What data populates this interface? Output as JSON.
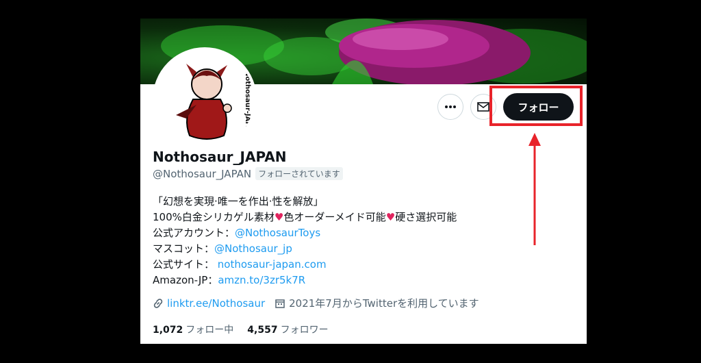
{
  "profile": {
    "display_name": "Nothosaur_JAPAN",
    "handle": "@Nothosaur_JAPAN",
    "follows_you_badge": "フォローされています",
    "avatar_text": "Nothosaur-JAPAN"
  },
  "actions": {
    "more_icon": "more-horizontal-icon",
    "message_icon": "envelope-icon",
    "follow_label": "フォロー"
  },
  "bio": {
    "line1": "「幻想を実現·唯一を作出·性を解放」",
    "line2_a": "100%白金シリカゲル素材",
    "line2_b": "色オーダーメイド可能",
    "line2_c": "硬さ選択可能",
    "heart": "♥",
    "line3_label": "公式アカウント：",
    "line3_link": "@NothosaurToys",
    "line4_label": "マスコット：",
    "line4_link": "@Nothosaur_jp",
    "line5_label": "公式サイト：",
    "line5_link": "nothosaur-japan.com",
    "line6_label": "Amazon-JP：",
    "line6_link": "amzn.to/3zr5k7R"
  },
  "meta": {
    "link_icon": "link-icon",
    "link_text": "linktr.ee/Nothosaur",
    "calendar_icon": "calendar-icon",
    "joined_text": "2021年7月からTwitterを利用しています"
  },
  "stats": {
    "following_count": "1,072",
    "following_label": "フォロー中",
    "followers_count": "4,557",
    "followers_label": "フォロワー"
  },
  "colors": {
    "annotation_red": "#e8232a",
    "link_blue": "#1d9bf0",
    "follow_button": "#0f1419"
  }
}
